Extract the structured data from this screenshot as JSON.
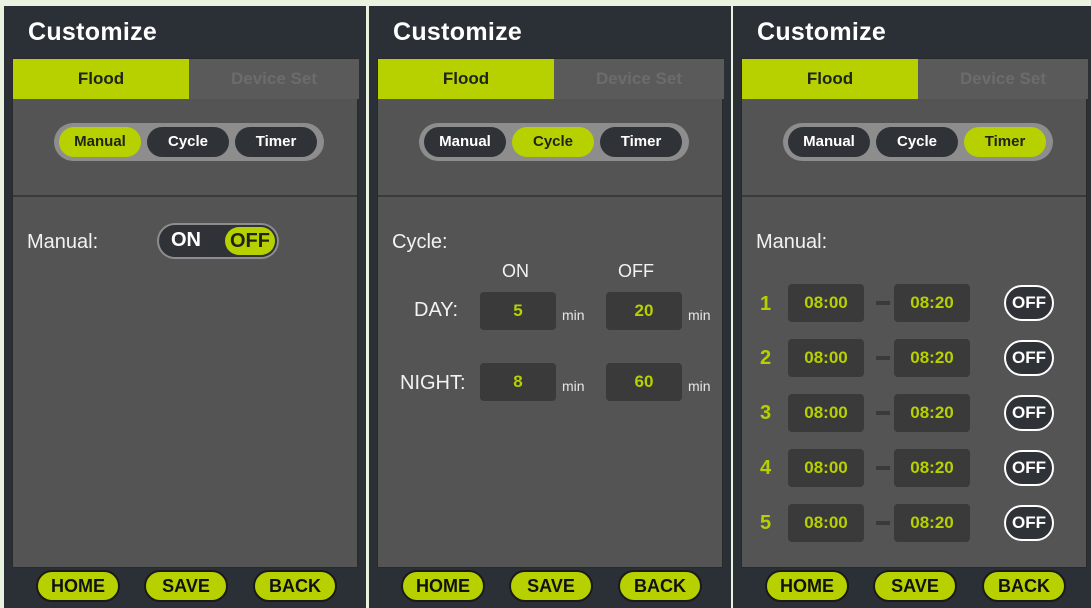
{
  "title": "Customize",
  "tabs": {
    "active": "Flood",
    "inactive": "Device Set"
  },
  "modes": [
    "Manual",
    "Cycle",
    "Timer"
  ],
  "nav": {
    "home": "HOME",
    "save": "SAVE",
    "back": "BACK"
  },
  "colors": {
    "accent": "#b7d000",
    "panel": "#2b3036",
    "content": "#545454"
  },
  "manual_screen": {
    "selected_mode": "Manual",
    "label": "Manual:",
    "toggle_on": "ON",
    "toggle_off": "OFF",
    "state": "OFF"
  },
  "cycle_screen": {
    "selected_mode": "Cycle",
    "label": "Cycle:",
    "col_on": "ON",
    "col_off": "OFF",
    "unit": "min",
    "day": {
      "label": "DAY:",
      "on": "5",
      "off": "20"
    },
    "night": {
      "label": "NIGHT:",
      "on": "8",
      "off": "60"
    }
  },
  "timer_screen": {
    "selected_mode": "Timer",
    "label": "Manual:",
    "rows": [
      {
        "n": "1",
        "start": "08:00",
        "end": "08:20",
        "state": "OFF"
      },
      {
        "n": "2",
        "start": "08:00",
        "end": "08:20",
        "state": "OFF"
      },
      {
        "n": "3",
        "start": "08:00",
        "end": "08:20",
        "state": "OFF"
      },
      {
        "n": "4",
        "start": "08:00",
        "end": "08:20",
        "state": "OFF"
      },
      {
        "n": "5",
        "start": "08:00",
        "end": "08:20",
        "state": "OFF"
      }
    ]
  }
}
